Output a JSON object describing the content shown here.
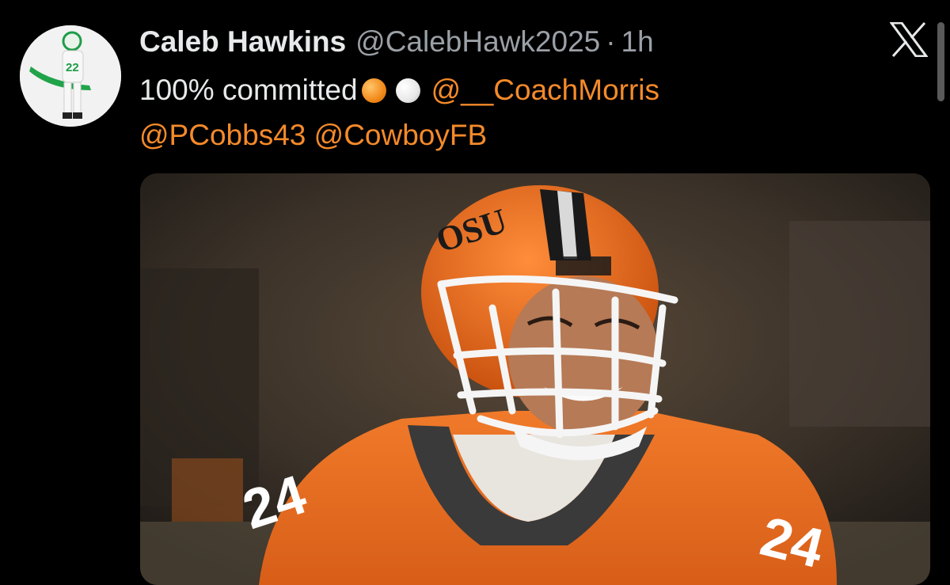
{
  "tweet": {
    "display_name": "Caleb Hawkins",
    "handle": "@CalebHawk2025",
    "separator": "·",
    "time": "1h",
    "text": "100% committed",
    "emojis": [
      "orange-circle",
      "white-circle"
    ],
    "mentions": [
      "@__CoachMorris",
      "@PCobbs43",
      "@CowboyFB"
    ],
    "media_helmet_logo": "OSU",
    "media_jersey_number": "24"
  },
  "colors": {
    "background": "#000000",
    "mention": "#f58a2a",
    "secondary_text": "#9aa0a6",
    "primary_text": "#e7e9ea"
  },
  "icons": {
    "platform": "x-logo-icon"
  }
}
